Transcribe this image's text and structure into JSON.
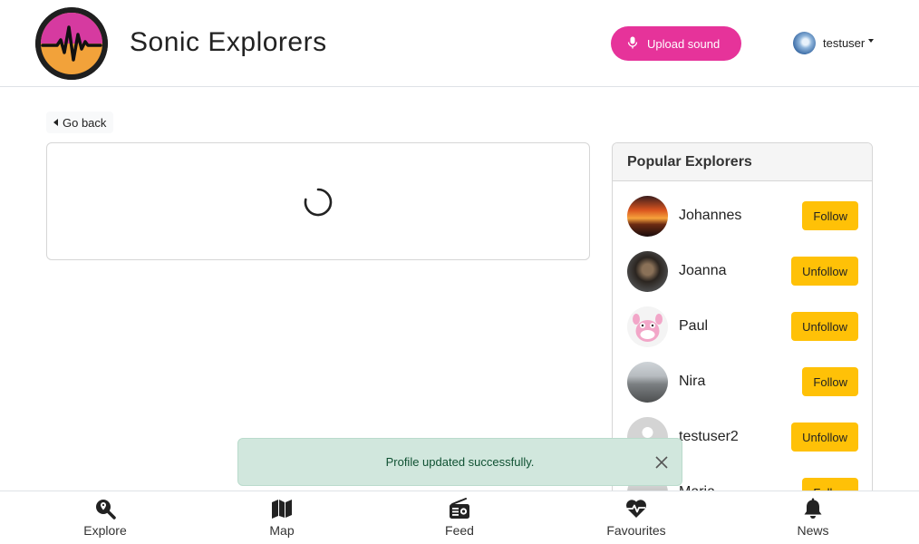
{
  "header": {
    "brand": "Sonic Explorers",
    "upload_label": "Upload sound",
    "username": "testuser"
  },
  "nav": {
    "go_back": "Go back"
  },
  "sidebar": {
    "title": "Popular Explorers",
    "explorers": [
      {
        "name": "Johannes",
        "action": "Follow"
      },
      {
        "name": "Joanna",
        "action": "Unfollow"
      },
      {
        "name": "Paul",
        "action": "Unfollow"
      },
      {
        "name": "Nira",
        "action": "Follow"
      },
      {
        "name": "testuser2",
        "action": "Unfollow"
      },
      {
        "name": "Maria",
        "action": "Follow"
      }
    ]
  },
  "toast": {
    "message": "Profile updated successfully."
  },
  "bottom_nav": [
    {
      "label": "Explore",
      "icon": "search-location-icon"
    },
    {
      "label": "Map",
      "icon": "map-icon"
    },
    {
      "label": "Feed",
      "icon": "radio-icon"
    },
    {
      "label": "Favourites",
      "icon": "heartbeat-icon"
    },
    {
      "label": "News",
      "icon": "bell-icon"
    }
  ],
  "colors": {
    "accent": "#e6339a",
    "button": "#ffc107",
    "toast_bg": "#d1e7dd",
    "toast_text": "#0f5132"
  }
}
